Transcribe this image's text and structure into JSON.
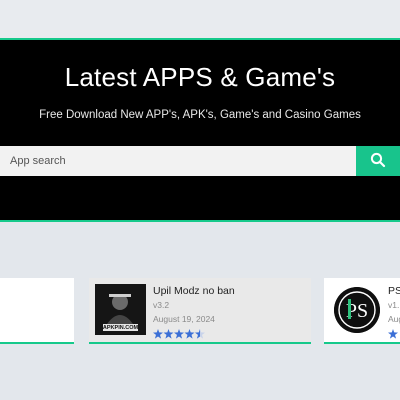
{
  "header": {
    "title": "Latest APPS & Game's",
    "subtitle": "Free Download New APP's, APK's, Game's and Casino Games"
  },
  "search": {
    "placeholder": "App search",
    "button_icon": "search-icon"
  },
  "apps": [
    {
      "name": "Upil Modz no ban",
      "version": "v3.2",
      "date": "August 19, 2024",
      "rating_stars": 4.5,
      "thumb_text": "APKPIN.COM"
    },
    {
      "name": "PS",
      "version": "v1.",
      "date": "Aug",
      "thumb_text": "PS"
    }
  ],
  "colors": {
    "accent": "#18c48c",
    "hero_bg": "#000000",
    "page_bg": "#e3e7ec",
    "star": "#3b6fd6"
  }
}
